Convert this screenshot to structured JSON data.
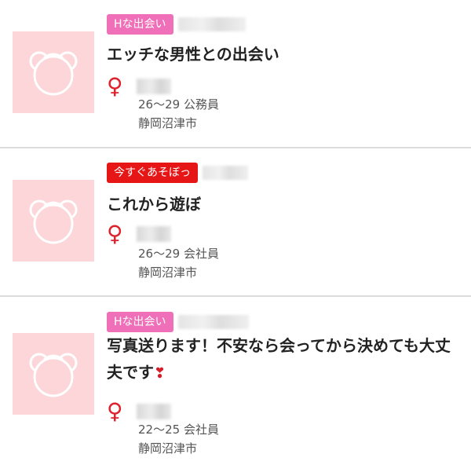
{
  "listings": [
    {
      "badge": "Hな出会い",
      "badge_color": "#ef6fb8",
      "title": "エッチな男性との出会い",
      "title_emoji": "",
      "gender_symbol": "♀",
      "age_job": "26〜29 公務員",
      "location": "静岡沼津市"
    },
    {
      "badge": "今すぐあそぼっ",
      "badge_color": "#e61616",
      "title": "これから遊ぼ",
      "title_emoji": "",
      "gender_symbol": "♀",
      "age_job": "26〜29 会社員",
      "location": "静岡沼津市"
    },
    {
      "badge": "Hな出会い",
      "badge_color": "#ef6fb8",
      "title": "写真送ります！不安なら会ってから決めても大丈夫です",
      "title_emoji": "❣",
      "gender_symbol": "♀",
      "age_job": "22〜25 会社員",
      "location": "静岡沼津市"
    }
  ],
  "icons": {
    "avatar": "bear-placeholder-icon",
    "gender": "female-icon"
  },
  "colors": {
    "avatar_bg": "#fcd6d8",
    "female": "#e0202a",
    "divider": "#dcdcdc"
  }
}
